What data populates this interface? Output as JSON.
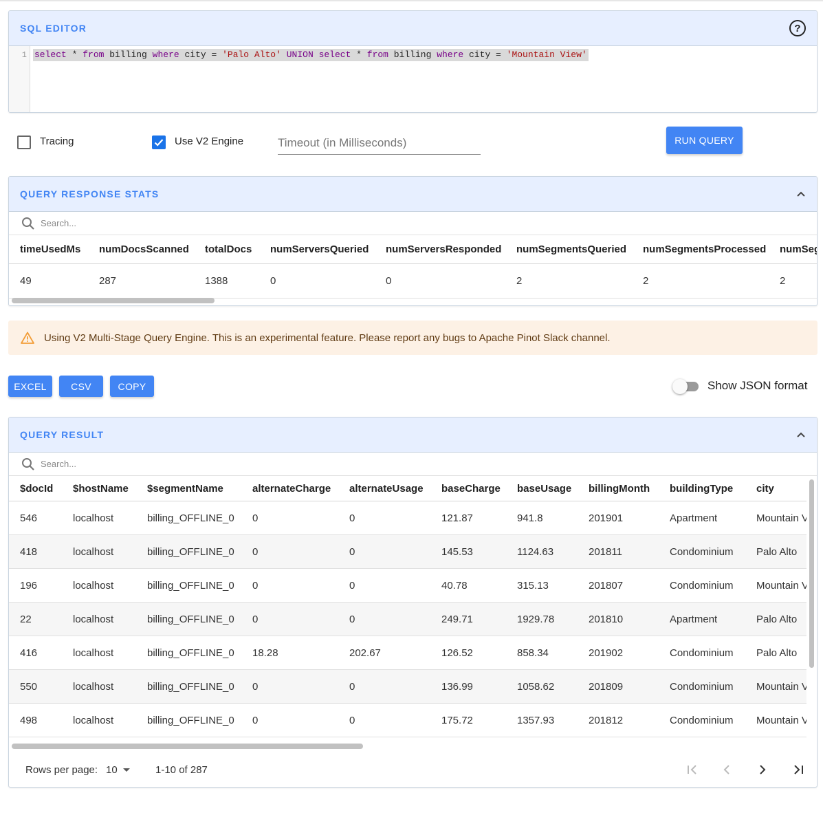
{
  "sql_editor": {
    "title": "SQL EDITOR",
    "line_number": "1",
    "query_tokens": [
      {
        "t": "select",
        "k": "kw"
      },
      {
        "t": " * ",
        "k": "plain"
      },
      {
        "t": "from",
        "k": "kw"
      },
      {
        "t": " billing ",
        "k": "plain"
      },
      {
        "t": "where",
        "k": "kw"
      },
      {
        "t": " city = ",
        "k": "plain"
      },
      {
        "t": "'Palo Alto'",
        "k": "str"
      },
      {
        "t": " ",
        "k": "plain"
      },
      {
        "t": "UNION",
        "k": "kw"
      },
      {
        "t": " ",
        "k": "plain"
      },
      {
        "t": "select",
        "k": "kw"
      },
      {
        "t": " * ",
        "k": "plain"
      },
      {
        "t": "from",
        "k": "kw"
      },
      {
        "t": " billing ",
        "k": "plain"
      },
      {
        "t": "where",
        "k": "kw"
      },
      {
        "t": " city = ",
        "k": "plain"
      },
      {
        "t": "'Mountain View'",
        "k": "str"
      }
    ],
    "help_icon": "?"
  },
  "options": {
    "tracing_label": "Tracing",
    "tracing_checked": false,
    "v2_label": "Use V2 Engine",
    "v2_checked": true,
    "timeout_placeholder": "Timeout (in Milliseconds)",
    "run_query_label": "RUN QUERY"
  },
  "stats": {
    "title": "QUERY RESPONSE STATS",
    "search_placeholder": "Search...",
    "columns": [
      "timeUsedMs",
      "numDocsScanned",
      "totalDocs",
      "numServersQueried",
      "numServersResponded",
      "numSegmentsQueried",
      "numSegmentsProcessed",
      "numSeg"
    ],
    "values": [
      "49",
      "287",
      "1388",
      "0",
      "0",
      "2",
      "2",
      "2"
    ]
  },
  "warning": {
    "icon": "warning-icon",
    "text": "Using V2 Multi-Stage Query Engine. This is an experimental feature. Please report any bugs to Apache Pinot Slack channel."
  },
  "actions": {
    "excel_label": "EXCEL",
    "csv_label": "CSV",
    "copy_label": "COPY",
    "json_toggle_label": "Show JSON format",
    "json_toggle_on": false
  },
  "result": {
    "title": "QUERY RESULT",
    "search_placeholder": "Search...",
    "columns": [
      "$docId",
      "$hostName",
      "$segmentName",
      "alternateCharge",
      "alternateUsage",
      "baseCharge",
      "baseUsage",
      "billingMonth",
      "buildingType",
      "city"
    ],
    "rows": [
      [
        "546",
        "localhost",
        "billing_OFFLINE_0",
        "0",
        "0",
        "121.87",
        "941.8",
        "201901",
        "Apartment",
        "Mountain View"
      ],
      [
        "418",
        "localhost",
        "billing_OFFLINE_0",
        "0",
        "0",
        "145.53",
        "1124.63",
        "201811",
        "Condominium",
        "Palo Alto"
      ],
      [
        "196",
        "localhost",
        "billing_OFFLINE_0",
        "0",
        "0",
        "40.78",
        "315.13",
        "201807",
        "Condominium",
        "Mountain View"
      ],
      [
        "22",
        "localhost",
        "billing_OFFLINE_0",
        "0",
        "0",
        "249.71",
        "1929.78",
        "201810",
        "Apartment",
        "Palo Alto"
      ],
      [
        "416",
        "localhost",
        "billing_OFFLINE_0",
        "18.28",
        "202.67",
        "126.52",
        "858.34",
        "201902",
        "Condominium",
        "Palo Alto"
      ],
      [
        "550",
        "localhost",
        "billing_OFFLINE_0",
        "0",
        "0",
        "136.99",
        "1058.62",
        "201809",
        "Condominium",
        "Mountain View"
      ],
      [
        "498",
        "localhost",
        "billing_OFFLINE_0",
        "0",
        "0",
        "175.72",
        "1357.93",
        "201812",
        "Condominium",
        "Mountain View"
      ]
    ],
    "rows_per_page_label": "Rows per page:",
    "rows_per_page_value": "10",
    "range_label": "1-10 of 287"
  }
}
